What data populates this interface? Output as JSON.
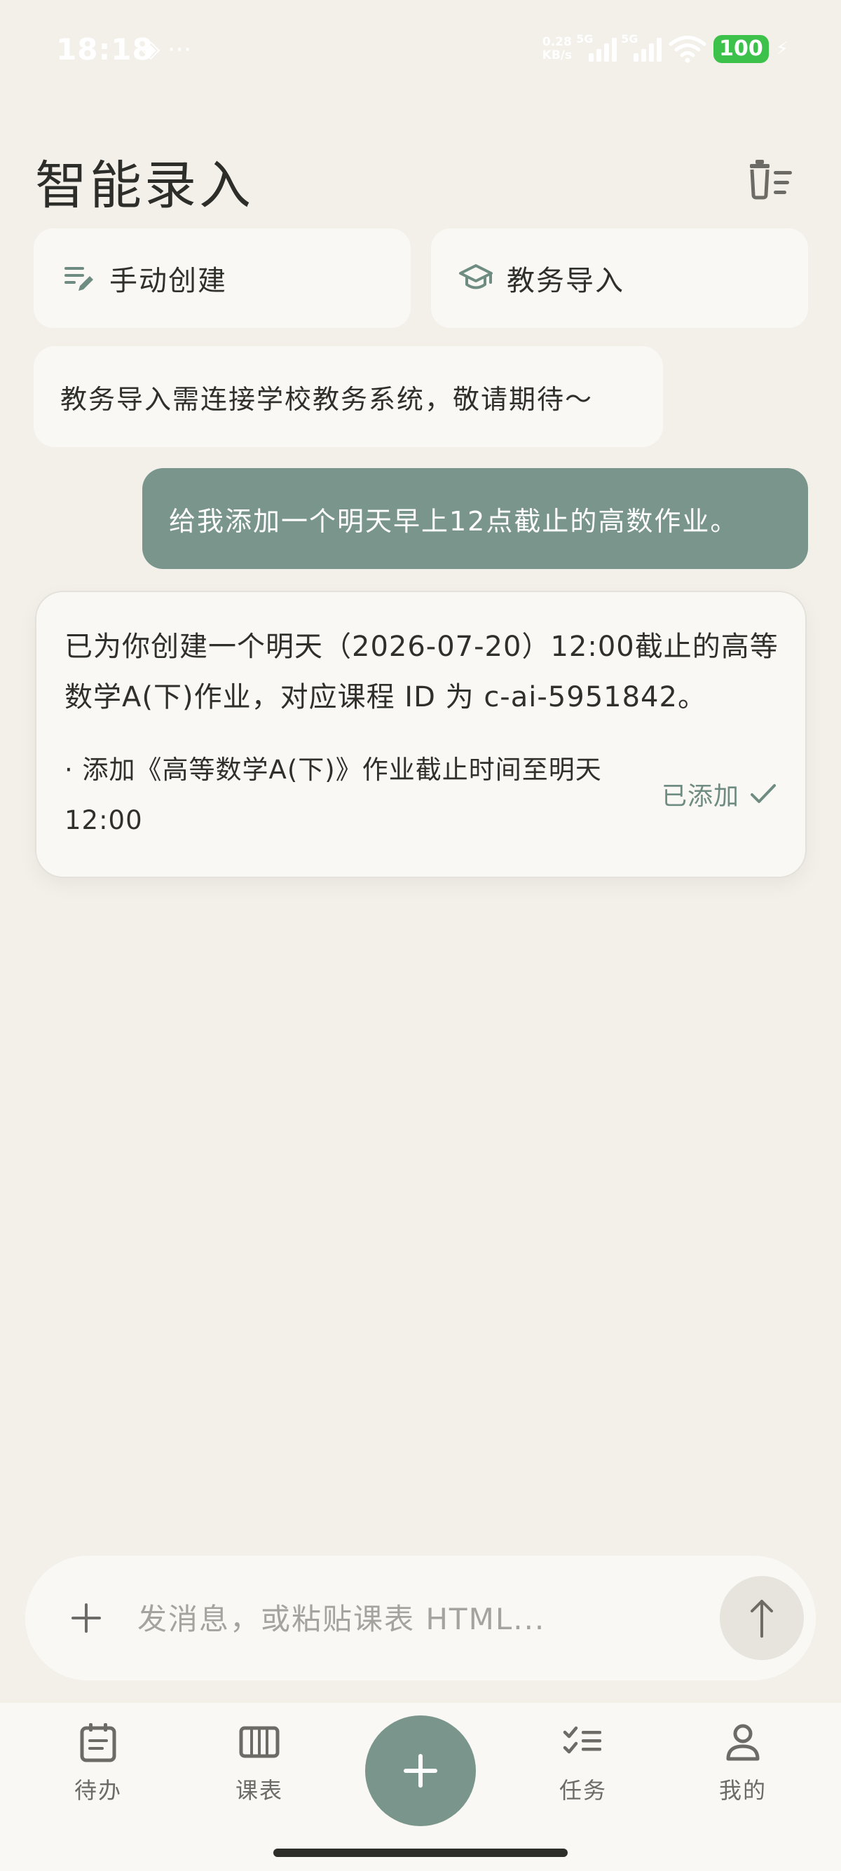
{
  "status_bar": {
    "time": "18:18",
    "extra_icons": "◈ ⋯",
    "net_speed_value": "0.28",
    "net_speed_unit": "KB/s",
    "sim1_tag": "5G",
    "sim2_tag": "5G",
    "battery": "100"
  },
  "header": {
    "title": "智能录入",
    "clear_icon": "clear-list-icon"
  },
  "actions": {
    "manual_label": "手动创建",
    "import_label": "教务导入"
  },
  "messages": {
    "hint": "教务导入需连接学校教务系统，敬请期待～",
    "user": "给我添加一个明天早上12点截止的高数作业。",
    "reply": "已为你创建一个明天（2026-07-20）12:00截止的高等数学A(下)作业，对应课程 ID 为 c-ai-5951842。",
    "item_text": "· 添加《高等数学A(下)》作业截止时间至明天 12:00",
    "item_status": "已添加"
  },
  "composer": {
    "placeholder": "发消息，或粘贴课表 HTML..."
  },
  "nav": {
    "todo": "待办",
    "schedule": "课表",
    "tasks": "任务",
    "me": "我的"
  },
  "colors": {
    "accent": "#7a958b",
    "background": "#f3f0ea",
    "card": "#f9f8f4",
    "battery": "#3cc24b"
  }
}
